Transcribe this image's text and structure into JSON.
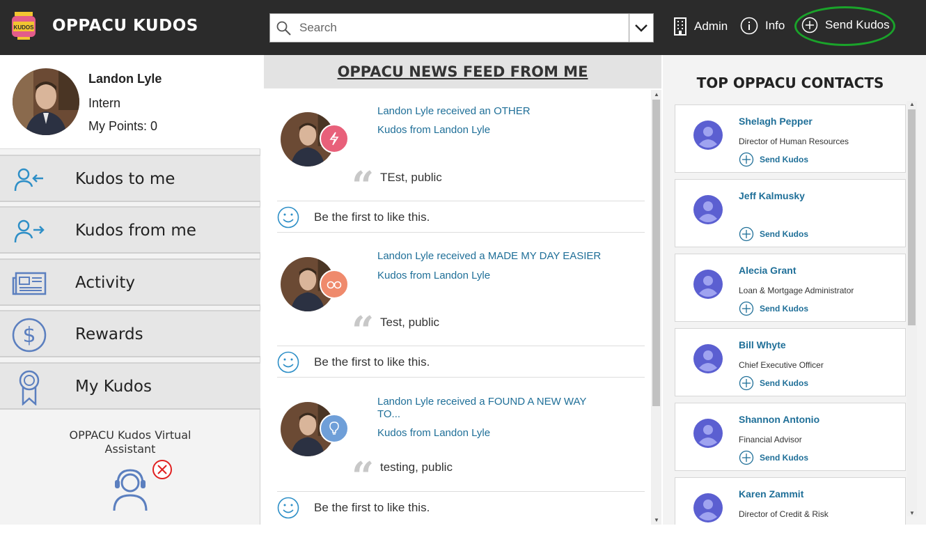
{
  "app": {
    "title": "OPPACU KUDOS",
    "logo_text": "KUDOS"
  },
  "search": {
    "placeholder": "Search"
  },
  "nav": {
    "admin": "Admin",
    "info": "Info",
    "send_kudos": "Send Kudos"
  },
  "profile": {
    "name": "Landon Lyle",
    "role": "Intern",
    "points": "My Points: 0"
  },
  "menu": [
    {
      "label": "Kudos to me",
      "icon": "user-arrow-in-icon"
    },
    {
      "label": "Kudos from me",
      "icon": "user-arrow-out-icon"
    },
    {
      "label": "Activity",
      "icon": "newspaper-icon"
    },
    {
      "label": "Rewards",
      "icon": "dollar-circle-icon"
    },
    {
      "label": "My Kudos",
      "icon": "award-ribbon-icon"
    }
  ],
  "assistant": {
    "label": "OPPACU Kudos Virtual Assistant"
  },
  "feed": {
    "title": "OPPACU NEWS FEED FROM ME",
    "posts": [
      {
        "line1": "Landon Lyle received an OTHER",
        "line2": "Kudos from Landon Lyle",
        "message": "TEst, public",
        "like_text": "Be the first to like this.",
        "badge_color": "#e8607a",
        "badge_icon": "lightning-icon"
      },
      {
        "line1": "Landon Lyle received a MADE MY DAY EASIER",
        "line2": "Kudos from Landon Lyle",
        "message": "Test, public",
        "like_text": "Be the first to like this.",
        "badge_color": "#ef8a6c",
        "badge_icon": "glasses-icon"
      },
      {
        "line1": "Landon Lyle received a FOUND A NEW WAY TO...",
        "line2": "Kudos from Landon Lyle",
        "message": "testing, public",
        "like_text": "Be the first to like this.",
        "badge_color": "#6f9fd8",
        "badge_icon": "lightbulb-icon"
      }
    ]
  },
  "contacts": {
    "title": "TOP OPPACU CONTACTS",
    "send_label": "Send Kudos",
    "items": [
      {
        "name": "Shelagh Pepper",
        "title": "Director of Human Resources"
      },
      {
        "name": "Jeff Kalmusky",
        "title": ""
      },
      {
        "name": "Alecia Grant",
        "title": "Loan & Mortgage Administrator"
      },
      {
        "name": "Bill Whyte",
        "title": "Chief Executive Officer"
      },
      {
        "name": "Shannon Antonio",
        "title": "Financial Advisor"
      },
      {
        "name": "Karen Zammit",
        "title": "Director of Credit & Risk"
      }
    ]
  },
  "colors": {
    "topbar": "#2b2b2b",
    "link": "#1f6f98",
    "highlight": "#1aa32a",
    "contact_avatar": "#5b5fd1"
  }
}
